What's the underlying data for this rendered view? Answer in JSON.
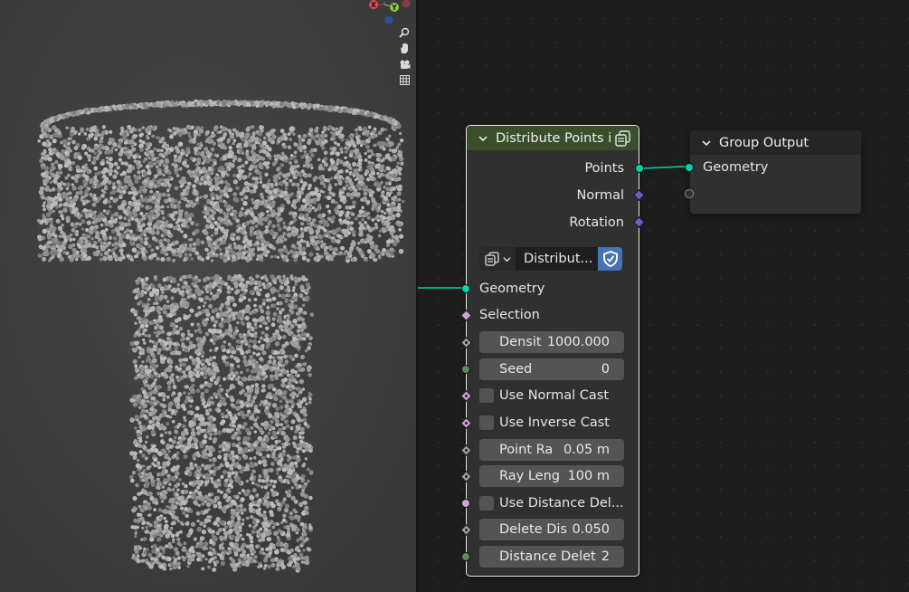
{
  "viewport": {
    "gizmo_axes": {
      "x": "X",
      "y": "Y"
    },
    "tools": [
      "zoom-icon",
      "hand-icon",
      "camera-icon",
      "grid-icon"
    ]
  },
  "nodes": {
    "distribute": {
      "title": "Distribute Points i",
      "header_color": "#3b4e2b",
      "outputs": [
        "Points",
        "Normal",
        "Rotation"
      ],
      "datablock_name": "Distribut...",
      "inputs": {
        "geometry": "Geometry",
        "selection": "Selection",
        "density": {
          "label": "Densit",
          "value": "1000.000"
        },
        "seed": {
          "label": "Seed",
          "value": "0"
        },
        "use_normal_cast": "Use Normal Cast",
        "use_inverse_cast": "Use Inverse Cast",
        "point_radius": {
          "label": "Point Ra",
          "value": "0.05 m"
        },
        "ray_length": {
          "label": "Ray Leng",
          "value": "100 m"
        },
        "use_distance_delete": "Use Distance Del...",
        "delete_distance": {
          "label": "Delete Dis",
          "value": "0.050"
        },
        "distance_delete": {
          "label": "Distance Delet",
          "value": "2"
        }
      }
    },
    "group_output": {
      "title": "Group Output",
      "inputs": [
        "Geometry"
      ]
    }
  },
  "colors": {
    "geometry_socket": "#00d6a3",
    "vector_socket": "#6363c7",
    "boolean_socket": "#cca6d6",
    "float_socket": "#a1a1a1",
    "integer_socket": "#598c5c",
    "selected_outline": "#e8e8e8",
    "accent": "#4772b3"
  }
}
